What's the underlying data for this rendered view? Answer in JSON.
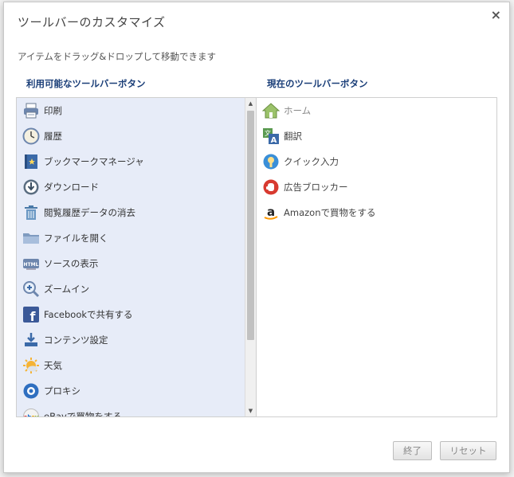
{
  "dialog": {
    "title": "ツールバーのカスタマイズ",
    "close_label": "×",
    "instruction": "アイテムをドラッグ&ドロップして移動できます"
  },
  "available": {
    "header": "利用可能なツールバーボタン",
    "items": [
      {
        "label": "印刷",
        "icon": "printer-icon"
      },
      {
        "label": "履歴",
        "icon": "clock-icon"
      },
      {
        "label": "ブックマークマネージャ",
        "icon": "bookmark-book-icon"
      },
      {
        "label": "ダウンロード",
        "icon": "download-circle-icon"
      },
      {
        "label": "閲覧履歴データの消去",
        "icon": "trash-icon"
      },
      {
        "label": "ファイルを開く",
        "icon": "folder-icon"
      },
      {
        "label": "ソースの表示",
        "icon": "html-source-icon"
      },
      {
        "label": "ズームイン",
        "icon": "zoom-in-icon"
      },
      {
        "label": "Facebookで共有する",
        "icon": "facebook-icon"
      },
      {
        "label": "コンテンツ設定",
        "icon": "content-settings-icon"
      },
      {
        "label": "天気",
        "icon": "weather-icon"
      },
      {
        "label": "プロキシ",
        "icon": "proxy-icon"
      },
      {
        "label": "eBayで買物をする",
        "icon": "ebay-icon"
      }
    ]
  },
  "current": {
    "header": "現在のツールバーボタン",
    "items": [
      {
        "label": "ホーム",
        "icon": "home-icon"
      },
      {
        "label": "翻訳",
        "icon": "translate-icon"
      },
      {
        "label": "クイック入力",
        "icon": "quick-input-icon"
      },
      {
        "label": "広告ブロッカー",
        "icon": "ad-blocker-icon"
      },
      {
        "label": "Amazonで買物をする",
        "icon": "amazon-icon"
      }
    ]
  },
  "buttons": {
    "done": "終了",
    "reset": "リセット"
  }
}
